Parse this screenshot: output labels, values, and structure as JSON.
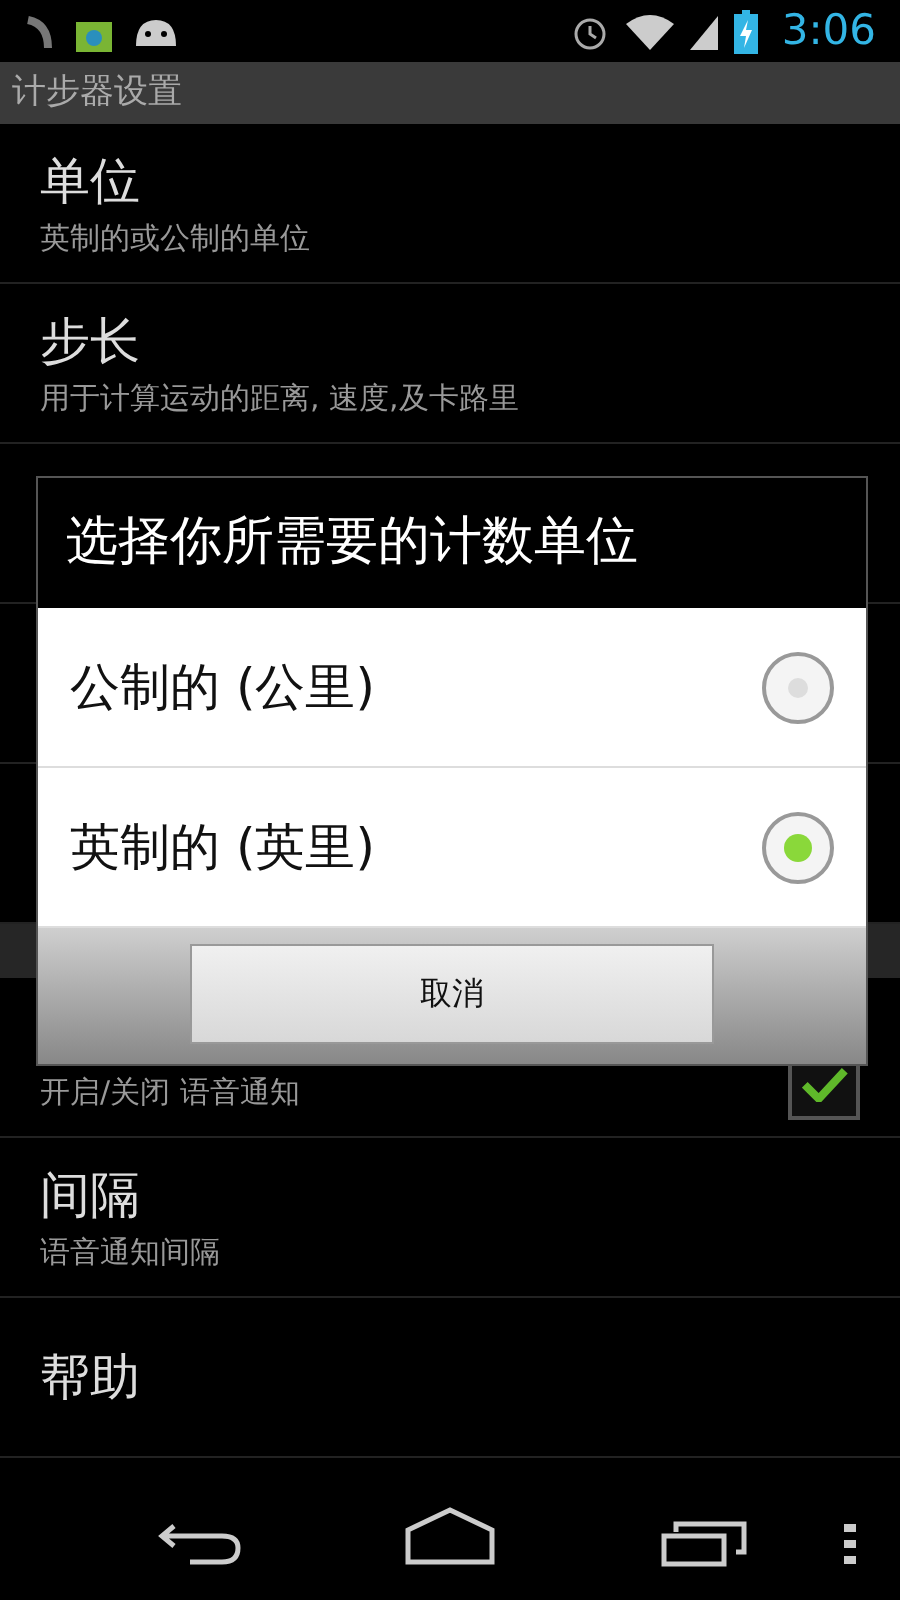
{
  "status_bar": {
    "time": "3:06"
  },
  "action_bar": {
    "title": "计步器设置"
  },
  "settings": [
    {
      "kind": "item",
      "title": "单位",
      "summary": "英制的或公制的单位"
    },
    {
      "kind": "item",
      "title": "步长",
      "summary": "用于计算运动的距离, 速度,及卡路里"
    },
    {
      "kind": "item"
    },
    {
      "kind": "item"
    },
    {
      "kind": "item"
    },
    {
      "kind": "header"
    },
    {
      "kind": "checkbox",
      "summary": "开启/关闭 语音通知",
      "checked": true
    },
    {
      "kind": "item",
      "title": "间隔",
      "summary": "语音通知间隔"
    },
    {
      "kind": "item",
      "title": "帮助"
    }
  ],
  "dialog": {
    "title": "选择你所需要的计数单位",
    "options": [
      {
        "label": "公制的 (公里)",
        "selected": false
      },
      {
        "label": "英制的 (英里)",
        "selected": true
      }
    ],
    "buttons": [
      "取消"
    ]
  }
}
